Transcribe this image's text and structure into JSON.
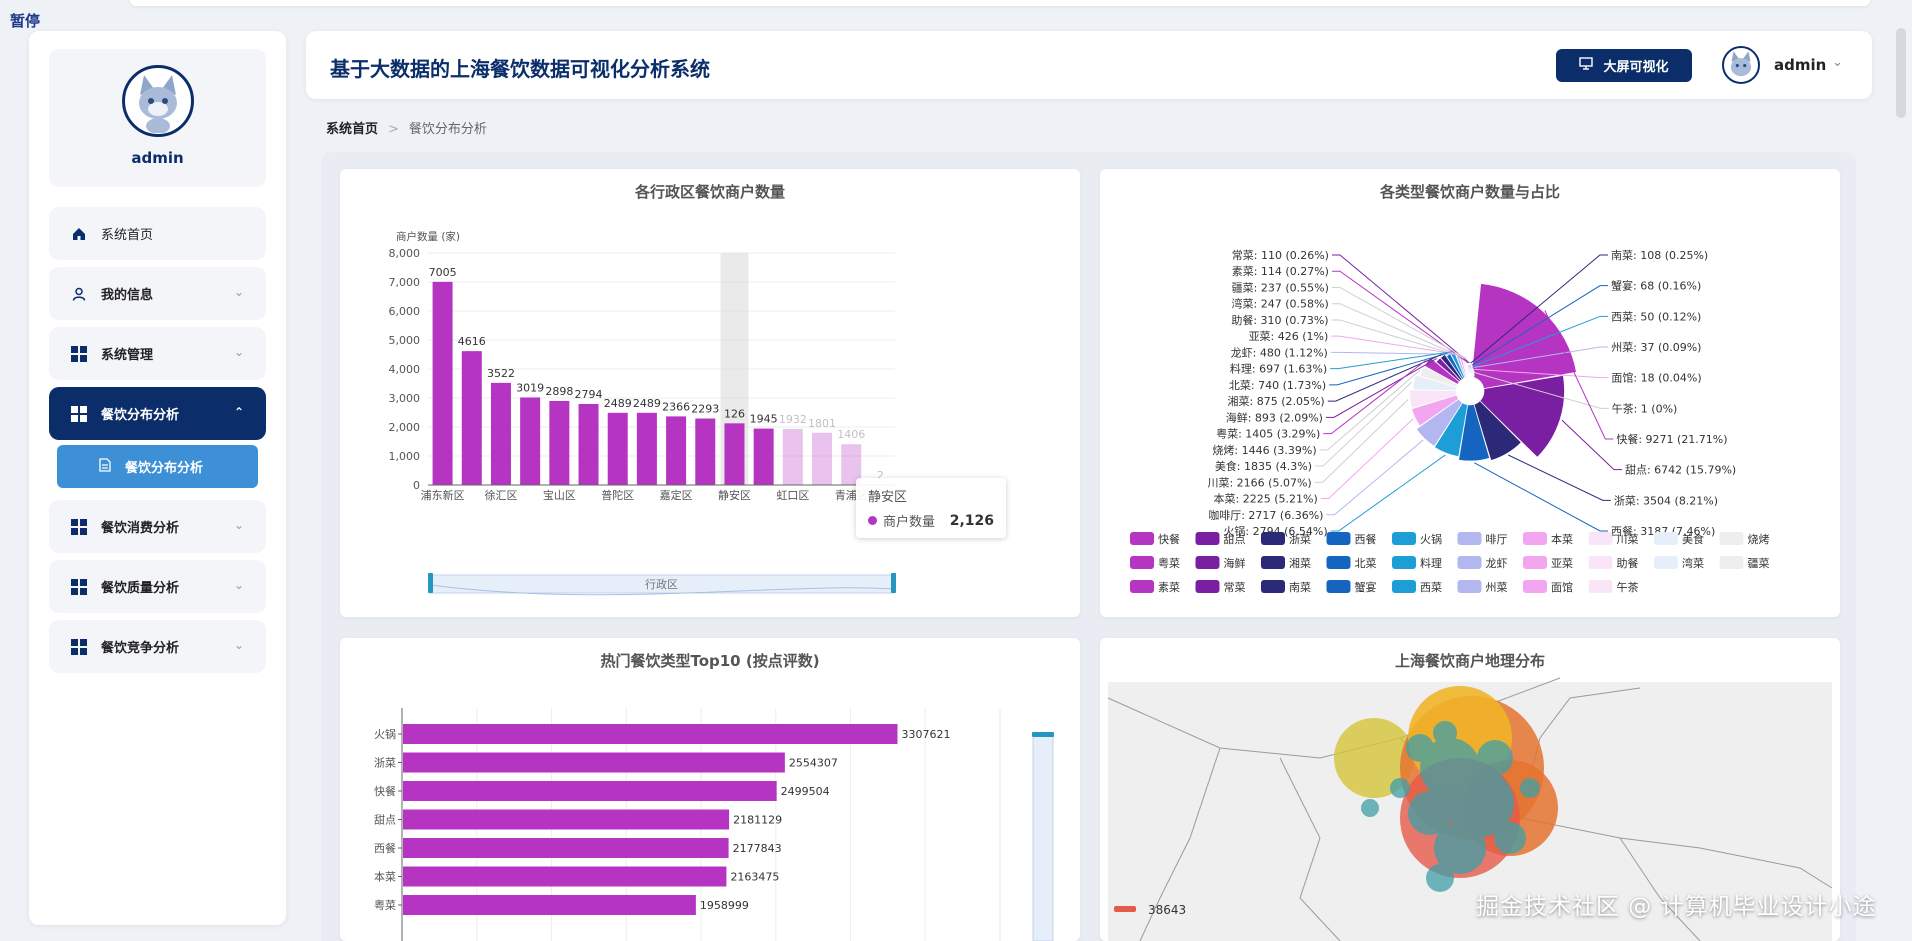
{
  "corner_tag": "暂停",
  "sidebar": {
    "user": "admin",
    "items": [
      {
        "label": "系统首页",
        "icon": "home-icon",
        "expandable": false,
        "active": false
      },
      {
        "label": "我的信息",
        "icon": "user-icon",
        "expandable": true,
        "active": false
      },
      {
        "label": "系统管理",
        "icon": "grid-icon",
        "expandable": true,
        "active": false
      },
      {
        "label": "餐饮分布分析",
        "icon": "grid-icon",
        "expandable": true,
        "active": true
      },
      {
        "label": "餐饮消费分析",
        "icon": "grid-icon",
        "expandable": true,
        "active": false
      },
      {
        "label": "餐饮质量分析",
        "icon": "grid-icon",
        "expandable": true,
        "active": false
      },
      {
        "label": "餐饮竞争分析",
        "icon": "grid-icon",
        "expandable": true,
        "active": false
      }
    ],
    "submenu": {
      "label": "餐饮分布分析",
      "icon": "document-icon"
    }
  },
  "header": {
    "title": "基于大数据的上海餐饮数据可视化分析系统",
    "bigscreen_label": "大屏可视化",
    "user": "admin"
  },
  "breadcrumb": {
    "home": "系统首页",
    "current": "餐饮分布分析"
  },
  "colors": {
    "navy": "#0b2e6b",
    "magenta": "#b535c2"
  },
  "panels": {
    "district": {
      "title": "各行政区餐饮商户数量",
      "tooltip": {
        "name": "静安区",
        "series": "商户数量",
        "value": "2,126"
      },
      "zoom_label": "行政区"
    },
    "category": {
      "title": "各类型餐饮商户数量与占比"
    },
    "top10": {
      "title": "热门餐饮类型Top10 (按点评数)"
    },
    "geo": {
      "title": "上海餐饮商户地理分布",
      "legend_value": "38643"
    }
  },
  "chart_data": [
    {
      "type": "bar",
      "title": "各行政区餐饮商户数量",
      "ylabel": "商户数量 (家)",
      "xlabel": "",
      "ylim": [
        0,
        8000
      ],
      "yticks": [
        "0",
        "1,000",
        "2,000",
        "3,000",
        "4,000",
        "5,000",
        "6,000",
        "7,000",
        "8,000"
      ],
      "categories": [
        "浦东新区",
        "",
        "徐汇区",
        "",
        "宝山区",
        "",
        "普陀区",
        "",
        "嘉定区",
        "",
        "静安区",
        "",
        "虹口区",
        "",
        "青浦区",
        ""
      ],
      "values": [
        7005,
        4616,
        3522,
        3019,
        2898,
        2794,
        2489,
        2489,
        2366,
        2293,
        2126,
        1945,
        1932,
        1801,
        1406,
        2
      ],
      "labels": [
        "7005",
        "4616",
        "3522",
        "3019",
        "2898",
        "2794",
        "2489",
        "2489",
        "2366",
        "2293",
        "126",
        "1945",
        "1932",
        "1801",
        "1406",
        "2"
      ],
      "highlight_index": 10,
      "grid": true
    },
    {
      "type": "pie",
      "title": "各类型餐饮商户数量与占比",
      "slices": [
        {
          "name": "快餐",
          "value": 9271,
          "label": "快餐: 9271 (21.71%)",
          "color": "#b535c2"
        },
        {
          "name": "甜点",
          "value": 6742,
          "label": "甜点: 6742 (15.79%)",
          "color": "#7b1fa2"
        },
        {
          "name": "浙菜",
          "value": 3504,
          "label": "浙菜: 3504 (8.21%)",
          "color": "#2c2a78"
        },
        {
          "name": "西餐",
          "value": 3187,
          "label": "西餐: 3187 (7.46%)",
          "color": "#1565c0"
        },
        {
          "name": "火锅",
          "value": 2794,
          "label": "火锅: 2794 (6.54%)",
          "color": "#1e9ed6"
        },
        {
          "name": "咖啡厅",
          "value": 2717,
          "label": "咖啡厅: 2717 (6.36%)",
          "color": "#b3b7f0"
        },
        {
          "name": "本菜",
          "value": 2225,
          "label": "本菜: 2225 (5.21%)",
          "color": "#f3a6f0"
        },
        {
          "name": "川菜",
          "value": 2166,
          "label": "川菜: 2166 (5.07%)",
          "color": "#f9e4f8"
        },
        {
          "name": "美食",
          "value": 1835,
          "label": "美食: 1835 (4.3%)",
          "color": "#e6eefa"
        },
        {
          "name": "烧烤",
          "value": 1446,
          "label": "烧烤: 1446 (3.39%)",
          "color": "#eeeeee"
        },
        {
          "name": "粤菜",
          "value": 1405,
          "label": "粤菜: 1405 (3.29%)",
          "color": "#b535c2"
        },
        {
          "name": "海鲜",
          "value": 893,
          "label": "海鲜: 893 (2.09%)",
          "color": "#7b1fa2"
        },
        {
          "name": "湘菜",
          "value": 875,
          "label": "湘菜: 875 (2.05%)",
          "color": "#2c2a78"
        },
        {
          "name": "北菜",
          "value": 740,
          "label": "北菜: 740 (1.73%)",
          "color": "#1565c0"
        },
        {
          "name": "料理",
          "value": 697,
          "label": "料理: 697 (1.63%)",
          "color": "#1e9ed6"
        },
        {
          "name": "龙虾",
          "value": 480,
          "label": "龙虾: 480 (1.12%)",
          "color": "#b3b7f0"
        },
        {
          "name": "亚菜",
          "value": 426,
          "label": "亚菜: 426 (1%)",
          "color": "#f3a6f0"
        },
        {
          "name": "助餐",
          "value": 310,
          "label": "助餐: 310 (0.73%)",
          "color": "#f9e4f8"
        },
        {
          "name": "湾菜",
          "value": 247,
          "label": "湾菜: 247 (0.58%)",
          "color": "#e6eefa"
        },
        {
          "name": "疆菜",
          "value": 237,
          "label": "疆菜: 237 (0.55%)",
          "color": "#eeeeee"
        },
        {
          "name": "素菜",
          "value": 114,
          "label": "素菜: 114 (0.27%)",
          "color": "#b535c2"
        },
        {
          "name": "常菜",
          "value": 110,
          "label": "常菜: 110 (0.26%)",
          "color": "#7b1fa2"
        },
        {
          "name": "南菜",
          "value": 108,
          "label": "南菜: 108 (0.25%)",
          "color": "#2c2a78"
        },
        {
          "name": "蟹宴",
          "value": 68,
          "label": "蟹宴: 68 (0.16%)",
          "color": "#1565c0"
        },
        {
          "name": "西菜",
          "value": 50,
          "label": "西菜: 50 (0.12%)",
          "color": "#1e9ed6"
        },
        {
          "name": "州菜",
          "value": 37,
          "label": "州菜: 37 (0.09%)",
          "color": "#b3b7f0"
        },
        {
          "name": "面馆",
          "value": 18,
          "label": "面馆: 18 (0.04%)",
          "color": "#f3a6f0"
        },
        {
          "name": "午茶",
          "value": 1,
          "label": "午茶: 1 (0%)",
          "color": "#f9e4f8"
        }
      ],
      "legend": [
        "快餐",
        "甜点",
        "浙菜",
        "西餐",
        "火锅",
        "啡厅",
        "本菜",
        "川菜",
        "美食",
        "烧烤",
        "粤菜",
        "海鲜",
        "湘菜",
        "北菜",
        "料理",
        "龙虾",
        "亚菜",
        "助餐",
        "湾菜",
        "疆菜",
        "素菜",
        "常菜",
        "南菜",
        "蟹宴",
        "西菜",
        "州菜",
        "面馆",
        "午茶"
      ],
      "legend_placement": "bottom"
    },
    {
      "type": "bar",
      "orientation": "horizontal",
      "title": "热门餐饮类型Top10 (按点评数)",
      "categories": [
        "火锅",
        "浙菜",
        "快餐",
        "甜点",
        "西餐",
        "本菜",
        "粤菜"
      ],
      "values": [
        3307621,
        2554307,
        2499504,
        2181129,
        2177843,
        2163475,
        1958999
      ],
      "xlim": [
        0,
        4000000
      ],
      "grid": true
    }
  ],
  "watermark": "掘金技术社区 @ 计算机毕业设计小途"
}
